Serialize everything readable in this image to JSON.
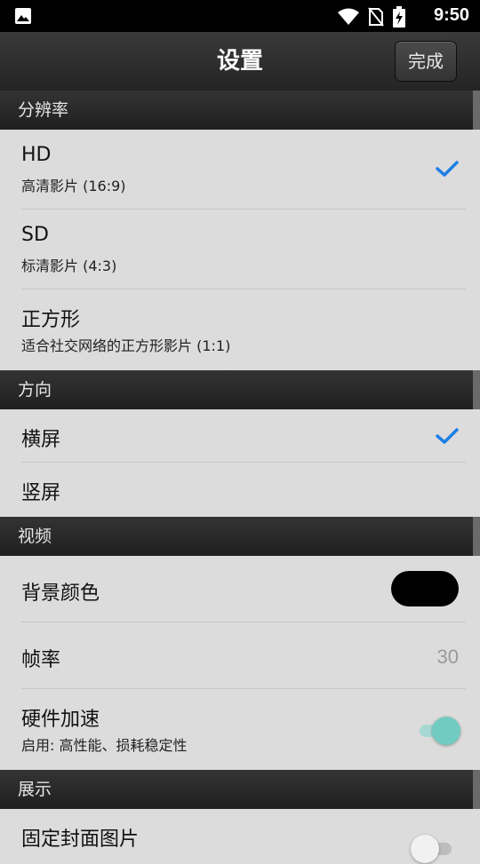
{
  "status_bar": {
    "time": "9:50",
    "icons": [
      "image-icon",
      "wifi-icon",
      "no-sim-icon",
      "battery-charging-icon"
    ]
  },
  "nav": {
    "title": "设置",
    "done_label": "完成"
  },
  "sections": {
    "resolution": {
      "header": "分辨率",
      "items": [
        {
          "title": "HD",
          "subtitle": "高清影片 (16:9)",
          "selected": true
        },
        {
          "title": "SD",
          "subtitle": "标清影片 (4:3)",
          "selected": false
        },
        {
          "title": "正方形",
          "subtitle": "适合社交网络的正方形影片 (1:1)",
          "selected": false
        }
      ]
    },
    "orientation": {
      "header": "方向",
      "items": [
        {
          "title": "横屏",
          "selected": true
        },
        {
          "title": "竖屏",
          "selected": false
        }
      ]
    },
    "video": {
      "header": "视频",
      "background_color": {
        "title": "背景颜色",
        "value_color": "#000000"
      },
      "frame_rate": {
        "title": "帧率",
        "value": "30"
      },
      "hw_accel": {
        "title": "硬件加速",
        "subtitle": "启用: 高性能、损耗稳定性",
        "enabled": true
      }
    },
    "display": {
      "header": "展示",
      "fixed_cover": {
        "title": "固定封面图片",
        "enabled": false
      }
    }
  },
  "colors": {
    "check": "#1e7ee6",
    "toggle_on": "#72cbc1",
    "header_bg": "#262626"
  }
}
